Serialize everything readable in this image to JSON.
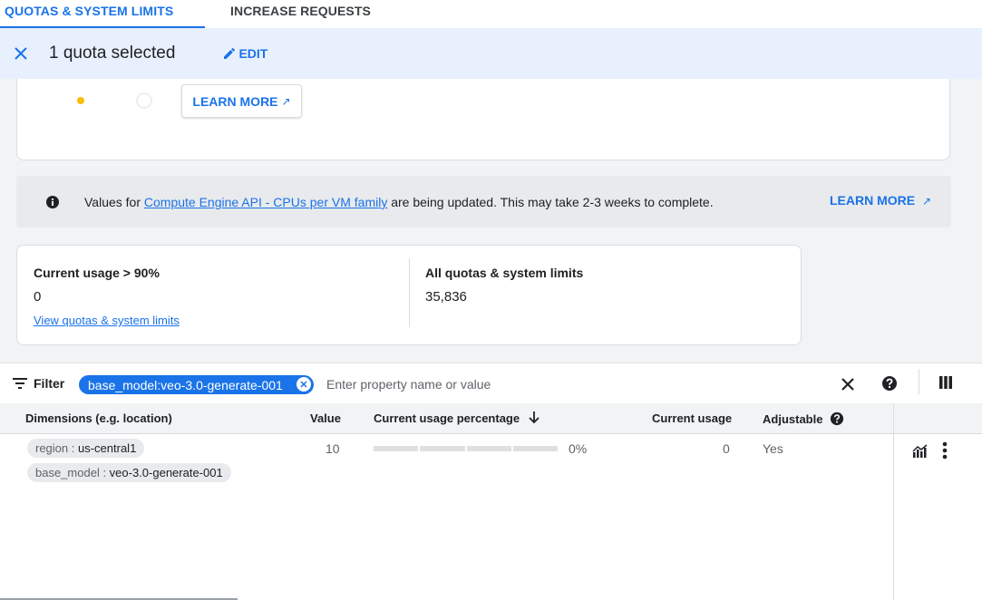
{
  "tabs": [
    {
      "label": "QUOTAS & SYSTEM LIMITS"
    },
    {
      "label": "INCREASE REQUESTS"
    }
  ],
  "selection_bar": {
    "count_text": "1 quota selected",
    "edit_label": "EDIT"
  },
  "top_card": {
    "learn_more_label": "LEARN MORE"
  },
  "banner": {
    "prefix": "Values for ",
    "link_text": "Compute Engine API - CPUs per VM family",
    "suffix": " are being updated. This may take 2-3 weeks to complete.",
    "learn_more_label": "LEARN MORE"
  },
  "summary": {
    "left_title": "Current usage > 90%",
    "left_value": "0",
    "left_link": "View quotas & system limits",
    "right_title": "All quotas & system limits",
    "right_value": "35,836"
  },
  "filter": {
    "label": "Filter",
    "chip_text": "base_model:veo-3.0-generate-001",
    "placeholder": "Enter property name or value"
  },
  "table": {
    "headers": {
      "dimensions": "Dimensions (e.g. location)",
      "value": "Value",
      "usage_pct": "Current usage percentage",
      "current_usage": "Current usage",
      "adjustable": "Adjustable"
    },
    "rows": [
      {
        "dimensions": [
          {
            "key": "region : ",
            "value": "us-central1"
          },
          {
            "key": "base_model : ",
            "value": "veo-3.0-generate-001"
          }
        ],
        "value": "10",
        "usage_pct": "0%",
        "usage_fraction": 0,
        "current_usage": "0",
        "adjustable": "Yes"
      }
    ]
  },
  "colors": {
    "accent": "#1a73e8",
    "selection_bg": "#e8f0fe",
    "status_dot": "#fbbc04"
  }
}
